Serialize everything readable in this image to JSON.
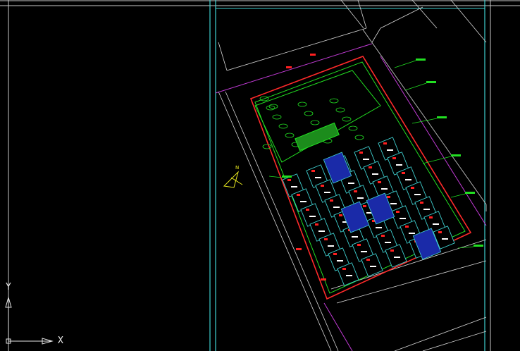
{
  "viewport": {
    "background": "#000000"
  },
  "ucs": {
    "x_label": "X",
    "y_label": "Y",
    "color": "#e6e6e6"
  },
  "drawing": {
    "north_arrow_label": "N",
    "colors": {
      "frame": "#c8c8c8",
      "border_cyan": "#3fd1d1",
      "road_line": "#d8d8d8",
      "boundary_red": "#ff2a2a",
      "boundary_magenta": "#c23bd6",
      "green_space": "#22e022",
      "building_fill": "#000000",
      "building_outline": "#3fd1d1",
      "parking_blue": "#1a2aa8",
      "label_white": "#ffffff",
      "label_red": "#ff2020",
      "yellow": "#e8e820"
    }
  }
}
